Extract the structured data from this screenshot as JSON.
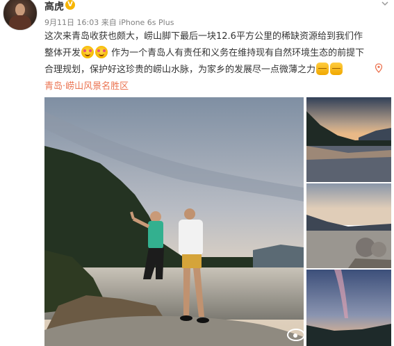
{
  "author": {
    "name": "高虎",
    "verified_badge": "V",
    "meta": "9月11日 16:03 来自 iPhone 6s Plus"
  },
  "post": {
    "line1": "这次来青岛收获也颇大，崂山脚下最后一块12.6平方公里的稀缺资源给到我们作",
    "line2a": "整体开发",
    "line2b": " 作为一个青岛人有责任和义务在维持现有自然环境生态的前提下",
    "line3": "合理规划，保护好这珍贵的崂山水脉，为家乡的发展尽一点微薄之力",
    "location": "青岛·崂山风景名胜区"
  },
  "icons": {
    "chevron": "chevron-down-icon",
    "location": "location-pin-icon",
    "emoji_smile": "blush-emoji",
    "emoji_fist": "fist-emoji"
  },
  "colors": {
    "location_link": "#eb7350",
    "verified": "#f7b500",
    "meta": "#808080"
  }
}
